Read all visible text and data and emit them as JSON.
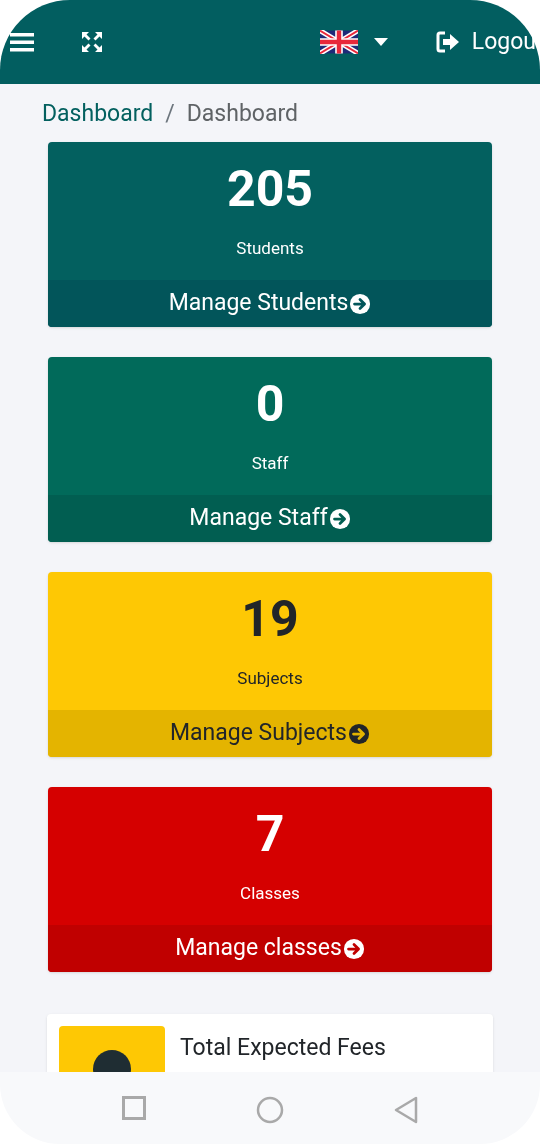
{
  "header": {
    "logout": "Logou"
  },
  "breadcrumb_separator": "/",
  "breadcrumb": [
    {
      "label": "Dashboard",
      "link": true
    },
    {
      "label": "Dashboard",
      "link": false
    }
  ],
  "stat_cards": [
    {
      "kind": "primary",
      "value": "205",
      "label": "Students",
      "action": "Manage Students"
    },
    {
      "kind": "success",
      "value": "0",
      "label": "Staff",
      "action": "Manage Staff"
    },
    {
      "kind": "warning",
      "value": "19",
      "label": "Subjects",
      "action": "Manage Subjects"
    },
    {
      "kind": "danger",
      "value": "7",
      "label": "Classes",
      "action": "Manage classes"
    }
  ],
  "info_box": {
    "title": "Total Expected Fees"
  }
}
